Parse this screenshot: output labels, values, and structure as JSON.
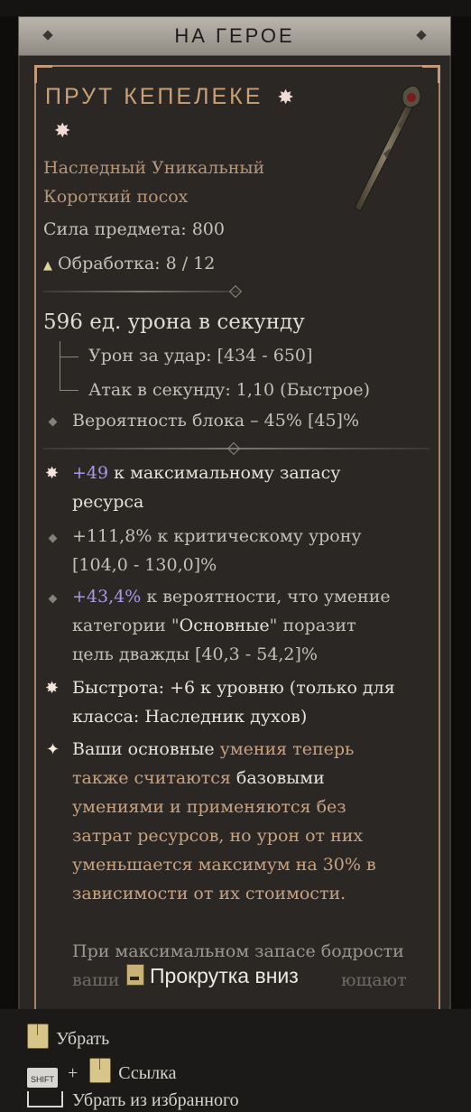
{
  "header": {
    "title": "НА ГЕРОЕ"
  },
  "item": {
    "name": "ПРУТ КЕПЕЛЕКЕ",
    "rarity_line": "Наследный Уникальный",
    "type_line": "Короткий посох",
    "power_line": "Сила предмета: 800",
    "upgrade_line": "Обработка: 8 / 12",
    "dps_line": "596 ед. урона в секунду",
    "damage_per_hit": "Урон за удар: [434 - 650]",
    "attacks_per_second": "Атак в секунду: 1,10 (Быстрое)",
    "block_chance": "Вероятность блока – 45% [45]%",
    "affixes": [
      {
        "value": "+49",
        "text1": " к максимальному запасу",
        "text2": "ресурса"
      },
      {
        "text1": "+111,8% к критическому урону",
        "text2": "[104,0 - 130,0]%"
      },
      {
        "value": "+43,4%",
        "text1": " к вероятности, что умение",
        "text2a": "категории \"",
        "text2b": "Основные",
        "text2c": "\" поразит",
        "text3": "цель дважды [40,3 - 54,2]%"
      },
      {
        "text1": "Быстрота: +6 к уровню (только для",
        "text2": "класса: Наследник духов)"
      }
    ],
    "unique": {
      "l1a": "Ваши ",
      "l1b": "основные",
      "l1c": " умения теперь",
      "l2a": "также считаются",
      "l2b": " базовыми",
      "l3": "умениями и применяются без",
      "l4": "затрат ресурсов, но урон от них",
      "l5": "уменьшается максимум на 30% в",
      "l6": "зависимости от их стоимости.",
      "l7": "При максимальном запасе бодрости",
      "l8a": "ваши",
      "l8b": "ющают"
    }
  },
  "scroll_hint": "Прокрутка вниз",
  "footer": {
    "remove": "Убрать",
    "shift_key": "SHIFT",
    "plus": "+",
    "link": "Ссылка",
    "unfavorite": "Убрать из избранного"
  },
  "colors": {
    "legendary_name": "#c9a078",
    "highlight_value": "#a59ae6",
    "unique_text": "#c9a27e"
  }
}
